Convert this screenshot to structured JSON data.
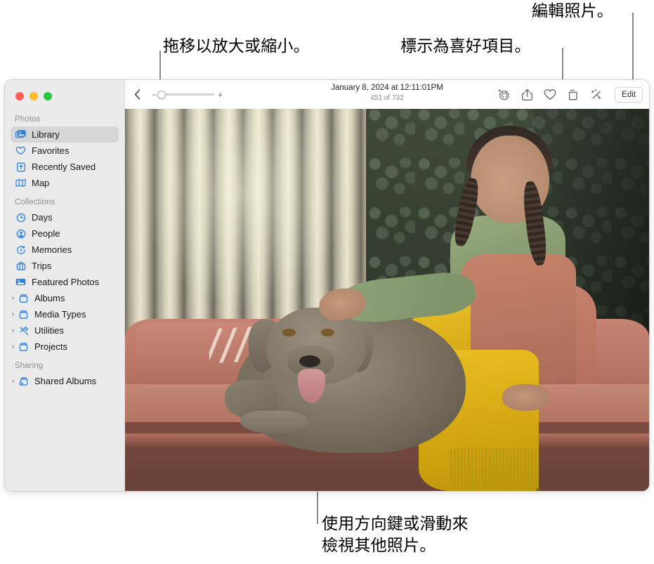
{
  "callouts": [
    {
      "id": "zoom-callout",
      "text": "拖移以放大或縮小。"
    },
    {
      "id": "favorite-callout",
      "text": "標示為喜好項目。"
    },
    {
      "id": "edit-callout",
      "text": "編輯照片。"
    },
    {
      "id": "browse-callout",
      "text": "使用方向鍵或滑動來\n檢視其他照片。"
    }
  ],
  "window": {
    "traffic_lights": [
      {
        "name": "close",
        "color": "#ff5f57"
      },
      {
        "name": "minimize",
        "color": "#ffbd2e"
      },
      {
        "name": "zoom",
        "color": "#28c840"
      }
    ]
  },
  "sidebar": {
    "sections": [
      {
        "header": "Photos",
        "items": [
          {
            "label": "Library",
            "icon": "library-icon",
            "selected": true,
            "disclosure": false
          },
          {
            "label": "Favorites",
            "icon": "heart-icon",
            "selected": false,
            "disclosure": false
          },
          {
            "label": "Recently Saved",
            "icon": "recently-saved-icon",
            "selected": false,
            "disclosure": false
          },
          {
            "label": "Map",
            "icon": "map-icon",
            "selected": false,
            "disclosure": false
          }
        ]
      },
      {
        "header": "Collections",
        "items": [
          {
            "label": "Days",
            "icon": "clock-icon",
            "selected": false,
            "disclosure": false
          },
          {
            "label": "People",
            "icon": "person-icon",
            "selected": false,
            "disclosure": false
          },
          {
            "label": "Memories",
            "icon": "memories-icon",
            "selected": false,
            "disclosure": false
          },
          {
            "label": "Trips",
            "icon": "trips-icon",
            "selected": false,
            "disclosure": false
          },
          {
            "label": "Featured Photos",
            "icon": "featured-photos-icon",
            "selected": false,
            "disclosure": false
          },
          {
            "label": "Albums",
            "icon": "album-icon",
            "selected": false,
            "disclosure": true
          },
          {
            "label": "Media Types",
            "icon": "album-icon",
            "selected": false,
            "disclosure": true
          },
          {
            "label": "Utilities",
            "icon": "utilities-icon",
            "selected": false,
            "disclosure": true
          },
          {
            "label": "Projects",
            "icon": "album-icon",
            "selected": false,
            "disclosure": true
          }
        ]
      },
      {
        "header": "Sharing",
        "items": [
          {
            "label": "Shared Albums",
            "icon": "shared-album-icon",
            "selected": false,
            "disclosure": true
          }
        ]
      }
    ]
  },
  "toolbar": {
    "back_icon": "chevron-left-icon",
    "zoom_out_label": "−",
    "zoom_in_label": "+",
    "zoom_value": 0,
    "title": "January 8, 2024 at 12:11:01PM",
    "subtitle": "451 of 732",
    "actions": [
      {
        "name": "visual-lookup-icon",
        "label": "Look Up"
      },
      {
        "name": "share-icon",
        "label": "Share"
      },
      {
        "name": "heart-icon",
        "label": "Favorite"
      },
      {
        "name": "rotate-icon",
        "label": "Rotate"
      },
      {
        "name": "magic-wand-icon",
        "label": "Auto Enhance"
      }
    ],
    "edit_label": "Edit"
  },
  "photo": {
    "alt": "Girl with braids petting a Weimaraner dog on a pink sofa with a yellow blanket, vertical blinds and dark green damask wallpaper behind"
  }
}
